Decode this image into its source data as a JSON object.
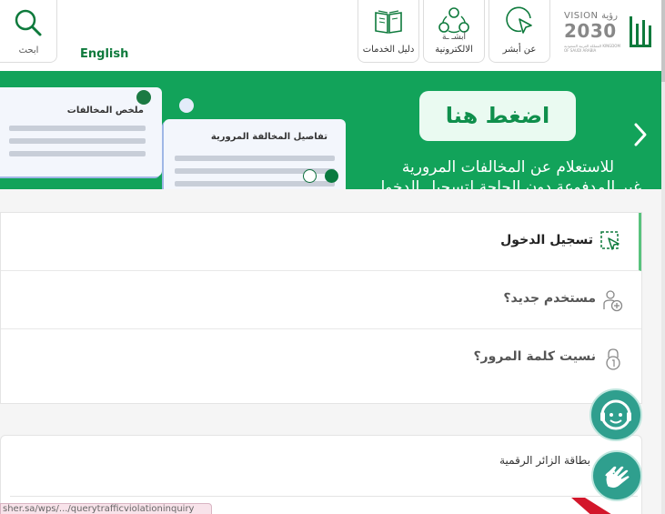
{
  "header": {
    "search_label": "ابحث",
    "language_link": "English",
    "about_label": "عن أبشر",
    "eservices_label": "الالكترونية",
    "eservices_partial": "أبشـ ـة",
    "guide_label": "دليل الخدمات",
    "vision_line1": "VISION رؤية",
    "vision_line2": "2030",
    "vision_line3": "المملكة العربية السعودية KINGDOM OF SAUDI ARABIA",
    "logo_text": "أبشر",
    "brand_color": "#12a35a"
  },
  "banner": {
    "cta_label": "اضغط هنا",
    "line1": "للاستعلام عن المخالفات المرورية",
    "line2": "غير المدفوعة دون الحاجة لتسجيل الدخول",
    "card_a_title": "ملخص المخالفات",
    "card_b_title": "تفاصيل المخالفة المرورية",
    "next_icon": "chevron-right-icon"
  },
  "login": {
    "items": [
      {
        "label": "تسجيل الدخول",
        "icon": "cursor-select-icon"
      },
      {
        "label": "مستخدم جديد؟",
        "icon": "user-add-icon"
      },
      {
        "label": "نسيت كلمة المرور؟",
        "icon": "lock-icon"
      }
    ]
  },
  "visitor": {
    "title": "بطاقة الزائر الرقمية"
  },
  "status_url": "sher.sa/wps/.../querytrafficviolationinquiry"
}
